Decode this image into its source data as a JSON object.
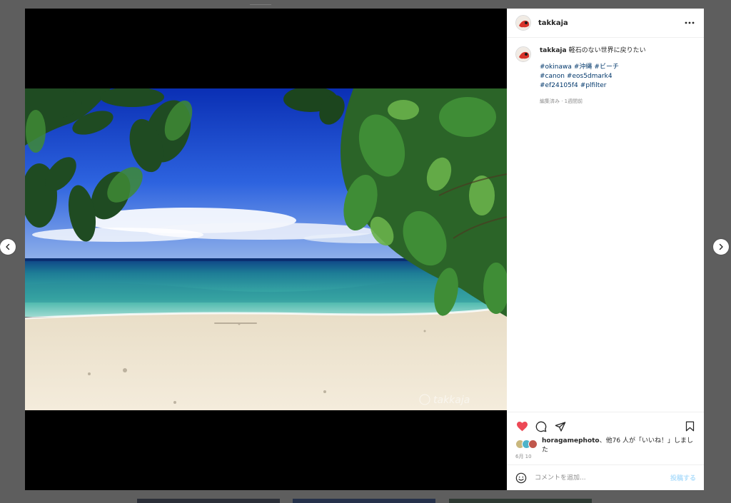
{
  "post": {
    "username": "takkaja",
    "caption": "軽石のない世界に戻りたい",
    "hashtags": [
      "#okinawa",
      "#沖縄",
      "#ビーチ",
      "#canon",
      "#eos5dmark4",
      "#ef24105f4",
      "#plfilter"
    ],
    "meta": "編集済み · 1週間前",
    "watermark": "takkaja"
  },
  "likes": {
    "first_user": "horagamephoto",
    "rest_text": "、他76 人が「いいね！」しました"
  },
  "date": "6月 10",
  "comment_box": {
    "placeholder": "コメントを追加...",
    "post_label": "投稿する"
  },
  "icons": {
    "liked": "heart-filled-icon",
    "comment": "comment-bubble-icon",
    "share": "paper-plane-icon",
    "save": "bookmark-icon",
    "more": "more-horizontal-icon",
    "emoji": "emoji-smile-icon",
    "prev": "chevron-left-icon",
    "next": "chevron-right-icon"
  },
  "colors": {
    "like": "#ed4956",
    "hashtag": "#00376b",
    "post_button_disabled": "#b2dffc",
    "backdrop": "#5e5e5e"
  }
}
